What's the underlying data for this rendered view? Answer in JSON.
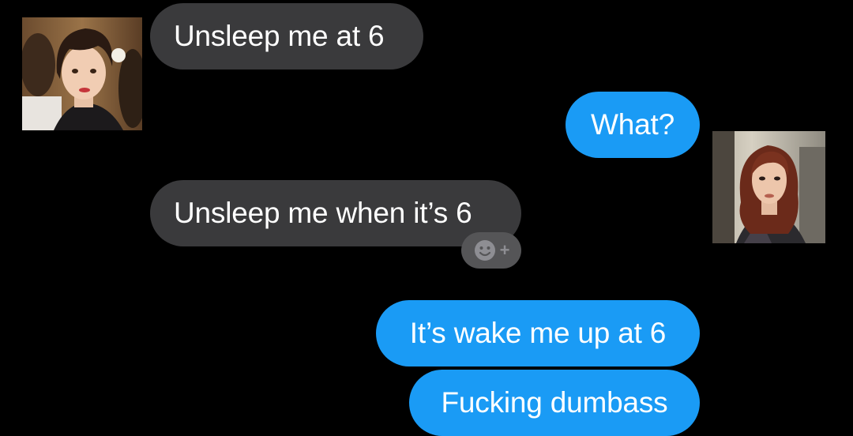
{
  "conversation": {
    "messages": [
      {
        "text": "Unsleep me at 6",
        "direction": "incoming"
      },
      {
        "text": "What?",
        "direction": "outgoing"
      },
      {
        "text": "Unsleep me when it’s 6",
        "direction": "incoming"
      },
      {
        "text": "It’s wake me up at 6",
        "direction": "outgoing"
      },
      {
        "text": "Fucking dumbass",
        "direction": "outgoing"
      }
    ],
    "tapback": {
      "icon": "add-reaction-icon",
      "symbol": "+"
    }
  },
  "colors": {
    "background": "#000000",
    "incoming_bubble": "#3a3a3c",
    "outgoing_bubble": "#1a9bf5",
    "text": "#ffffff"
  }
}
